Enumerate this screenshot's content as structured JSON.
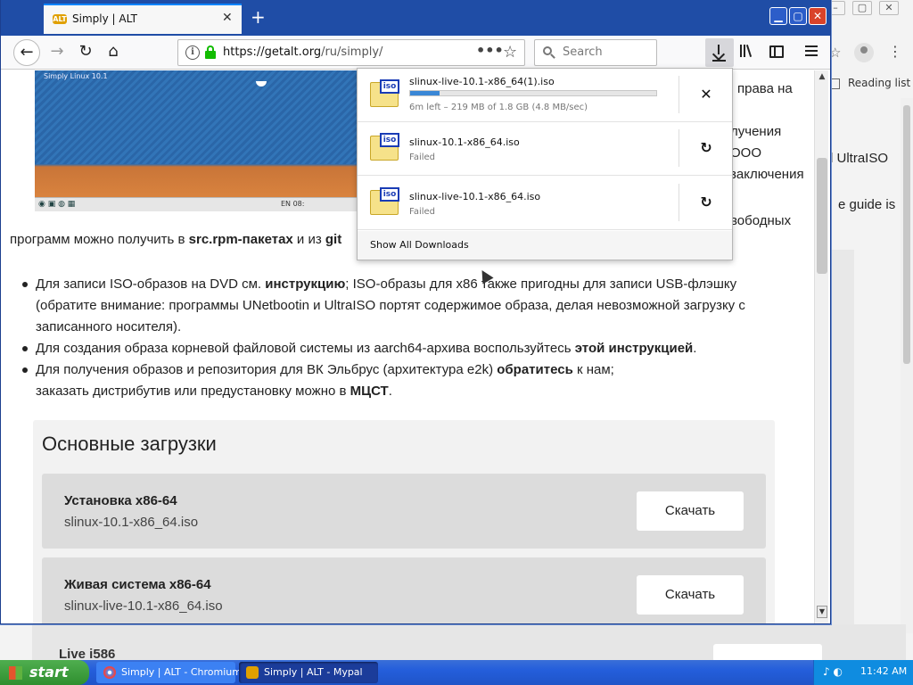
{
  "background_window": {
    "reading_list": "Reading list",
    "right_text": [
      "d UltraISO",
      "e guide is"
    ],
    "bottom_heading": "Live i586"
  },
  "browser": {
    "tab_title": "Simply | ALT",
    "url_domain": "https://getalt.org",
    "url_path": "/ru/simply/",
    "search_placeholder": "Search",
    "window_controls": {
      "minimize": "▁",
      "maximize": "▢",
      "close": "✕"
    }
  },
  "page": {
    "screenshot_label": "Simply Linux 10.1",
    "screenshot_tray": "EN 08:",
    "right_fragments": [
      "права на",
      "лучения",
      "ООО",
      "заключения",
      "вободных"
    ],
    "para_tail": {
      "text1": "программ можно получить в ",
      "bold1": "src.rpm-пакетах",
      "text2": " и из ",
      "bold2": "git"
    },
    "bullets": [
      {
        "parts": [
          {
            "t": "Для записи ISO-образов на DVD см. ",
            "b": false
          },
          {
            "t": "инструкцию",
            "b": true
          },
          {
            "t": "; ISO-образы для x86 также пригодны для записи USB-флэшку (обратите внимание: программы UNetbootin и UltraISO портят содержимое образа, делая невозможной загрузку с записанного носителя).",
            "b": false
          }
        ]
      },
      {
        "parts": [
          {
            "t": "Для создания образа корневой файловой системы из aarch64-архива воспользуйтесь ",
            "b": false
          },
          {
            "t": "этой инструкцией",
            "b": true
          },
          {
            "t": ".",
            "b": false
          }
        ]
      },
      {
        "parts": [
          {
            "t": "Для получения образов и репозитория для ВК Эльбрус (архитектура e2k) ",
            "b": false
          },
          {
            "t": "обратитесь",
            "b": true
          },
          {
            "t": " к нам;",
            "b": false
          },
          {
            "t": "\nзаказать дистрибутив или предустановку можно в ",
            "b": false
          },
          {
            "t": "МЦСТ",
            "b": true
          },
          {
            "t": ".",
            "b": false
          }
        ]
      }
    ],
    "downloads_title": "Основные загрузки",
    "cards": [
      {
        "title": "Установка x86-64",
        "file": "slinux-10.1-x86_64.iso",
        "button": "Скачать"
      },
      {
        "title": "Живая система x86-64",
        "file": "slinux-live-10.1-x86_64.iso",
        "button": "Скачать"
      }
    ]
  },
  "downloads_panel": {
    "items": [
      {
        "name": "slinux-live-10.1-x86_64(1).iso",
        "status": "6m left – 219 MB of 1.8 GB (4.8 MB/sec)",
        "progress": 0.12,
        "action": "✕",
        "icon_tag": "iso"
      },
      {
        "name": "slinux-10.1-x86_64.iso",
        "status": "Failed",
        "action": "↻",
        "icon_tag": "iso"
      },
      {
        "name": "slinux-live-10.1-x86_64.iso",
        "status": "Failed",
        "action": "↻",
        "icon_tag": "iso"
      }
    ],
    "show_all": "Show All Downloads"
  },
  "taskbar": {
    "start": "start",
    "tasks": [
      "Simply | ALT - Chromium",
      "Simply | ALT - Mypal"
    ],
    "clock": "11:42 AM"
  },
  "colors": {
    "accent": "#0a84ff",
    "titlebar": "#1f4da6",
    "progress": "#3a87d6",
    "xp_taskbar": "#245edb"
  }
}
